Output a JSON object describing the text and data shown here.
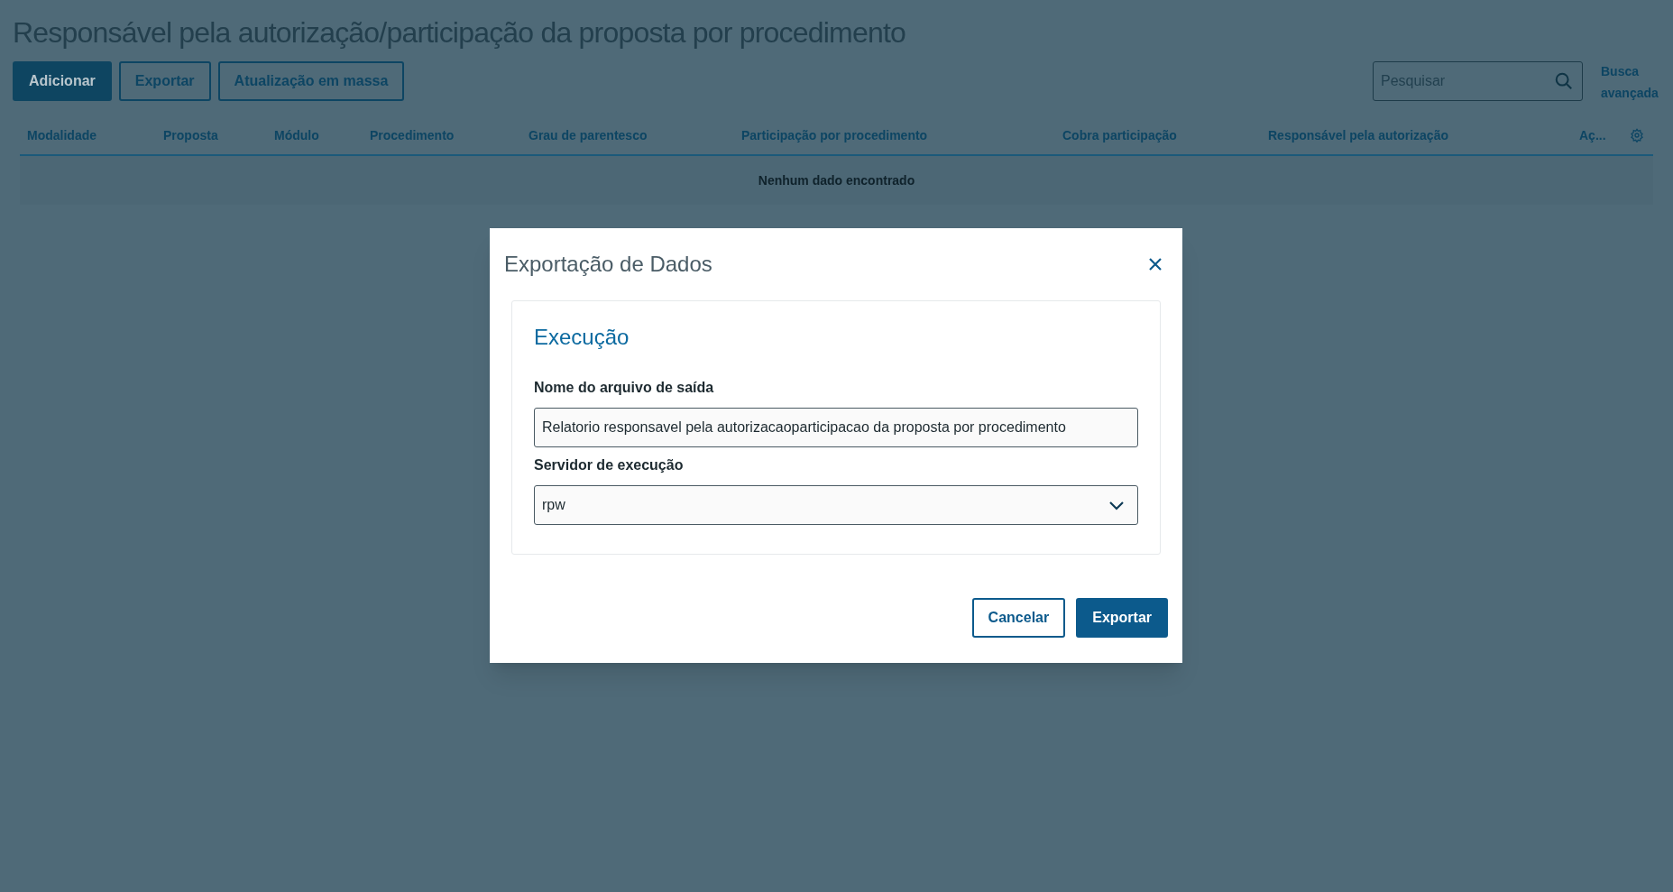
{
  "page": {
    "title": "Responsável pela autorização/participação da proposta por procedimento"
  },
  "actions": [
    {
      "label": "Adicionar",
      "kind": "primary"
    },
    {
      "label": "Exportar",
      "kind": "secondary"
    },
    {
      "label": "Atualização em massa",
      "kind": "secondary"
    }
  ],
  "search": {
    "placeholder": "Pesquisar",
    "advanced_link": "Busca avançada"
  },
  "table": {
    "columns": [
      "Modalidade",
      "Proposta",
      "Módulo",
      "Procedimento",
      "Grau de parentesco",
      "Participação por procedimento",
      "Cobra participação",
      "Responsável pela autorização",
      "Aç..."
    ],
    "empty_message": "Nenhum dado encontrado"
  },
  "dialog": {
    "title": "Exportação de Dados",
    "section_title": "Execução",
    "fields": [
      {
        "kind": "text",
        "label": "Nome do arquivo de saída",
        "value": "Relatorio responsavel pela autorizacaoparticipacao da proposta por procedimento"
      },
      {
        "kind": "select",
        "label": "Servidor de execução",
        "value": "rpw"
      }
    ],
    "buttons": [
      {
        "label": "Cancelar",
        "kind": "secondary"
      },
      {
        "label": "Exportar",
        "kind": "primary"
      }
    ]
  }
}
